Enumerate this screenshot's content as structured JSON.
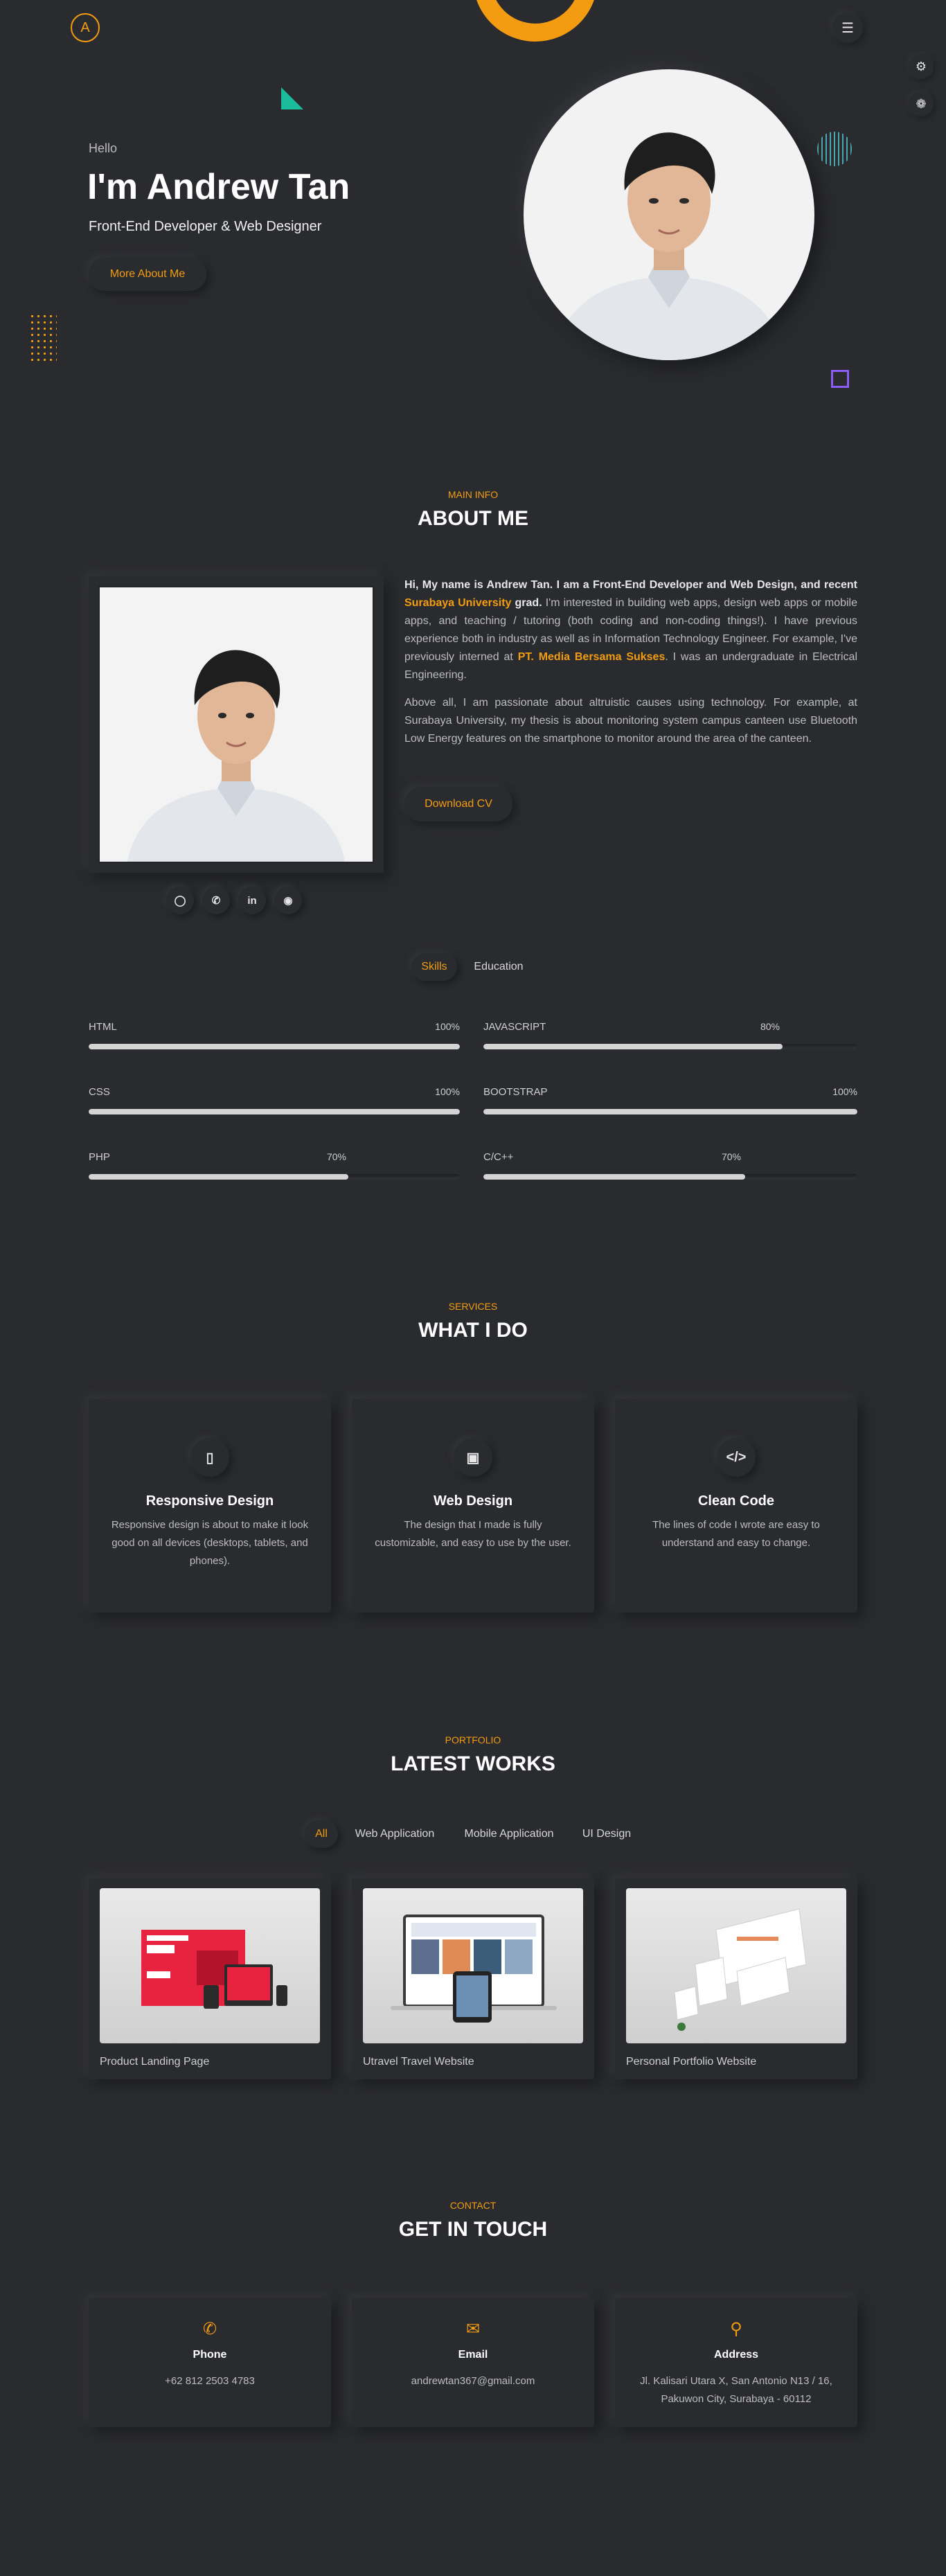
{
  "header": {
    "logo_letter": "A",
    "menu_icon": "hamburger-icon",
    "side_buttons": [
      "gear-icon",
      "settings-cog-icon"
    ]
  },
  "hero": {
    "greeting": "Hello",
    "name": "I'm Andrew Tan",
    "role": "Front-End Developer & Web Designer",
    "button": "More About Me"
  },
  "about": {
    "label": "MAIN INFO",
    "title": "ABOUT ME",
    "p1_intro": "Hi, My name is Andrew Tan. I am a Front-End Developer and Web Design, and recent",
    "p1_uni": "Surabaya University",
    "p1_grad": "grad.",
    "p1_rest": "I'm interested in building web apps, design web apps or mobile apps, and teaching / tutoring (both coding and non-coding things!). I have previous experience both in industry as well as in Information Technology Engineer. For example, I've previously interned at",
    "p1_company": "PT. Media Bersama Sukses",
    "p1_end": ". I was an undergraduate in Electrical Engineering.",
    "p2": "Above all, I am passionate about altruistic causes using technology. For example, at Surabaya University, my thesis is about monitoring system campus canteen use Bluetooth Low Energy features on the smartphone to monitor around the area of the canteen.",
    "cv_button": "Download CV",
    "socials": [
      "instagram-icon",
      "whatsapp-icon",
      "linkedin-icon",
      "github-icon"
    ]
  },
  "skills_tabs": [
    "Skills",
    "Education"
  ],
  "skills": [
    {
      "name": "HTML",
      "pct_label": "100%",
      "value": 1.0
    },
    {
      "name": "JAVASCRIPT",
      "pct_label": "80%",
      "value": 0.8
    },
    {
      "name": "CSS",
      "pct_label": "100%",
      "value": 1.0
    },
    {
      "name": "BOOTSTRAP",
      "pct_label": "100%",
      "value": 1.0
    },
    {
      "name": "PHP",
      "pct_label": "70%",
      "value": 0.7
    },
    {
      "name": "C/C++",
      "pct_label": "70%",
      "value": 0.7
    }
  ],
  "services": {
    "label": "SERVICES",
    "title": "WHAT I DO",
    "items": [
      {
        "icon": "mobile-icon",
        "title": "Responsive Design",
        "desc": "Responsive design is about to make it look good on all devices (desktops, tablets, and phones)."
      },
      {
        "icon": "laptop-icon",
        "title": "Web Design",
        "desc": "The design that I made is fully customizable, and easy to use by the user."
      },
      {
        "icon": "code-icon",
        "title": "Clean Code",
        "desc": "The lines of code I wrote are easy to understand and easy to change."
      }
    ]
  },
  "portfolio": {
    "label": "PORTFOLIO",
    "title": "LATEST WORKS",
    "filters": [
      "All",
      "Web Application",
      "Mobile Application",
      "UI Design"
    ],
    "works": [
      "Product Landing Page",
      "Utravel Travel Website",
      "Personal Portfolio Website"
    ]
  },
  "contact": {
    "label": "CONTACT",
    "title": "GET IN TOUCH",
    "items": [
      {
        "icon": "phone-icon",
        "title": "Phone",
        "value": "+62 812 2503 4783"
      },
      {
        "icon": "envelope-icon",
        "title": "Email",
        "value": "andrewtan367@gmail.com"
      },
      {
        "icon": "map-marker-icon",
        "title": "Address",
        "value": "Jl. Kalisari Utara X, San Antonio N13 / 16, Pakuwon City, Surabaya - 60112"
      }
    ]
  },
  "colors": {
    "accent": "#f39c12",
    "background": "#2a2b2f"
  }
}
